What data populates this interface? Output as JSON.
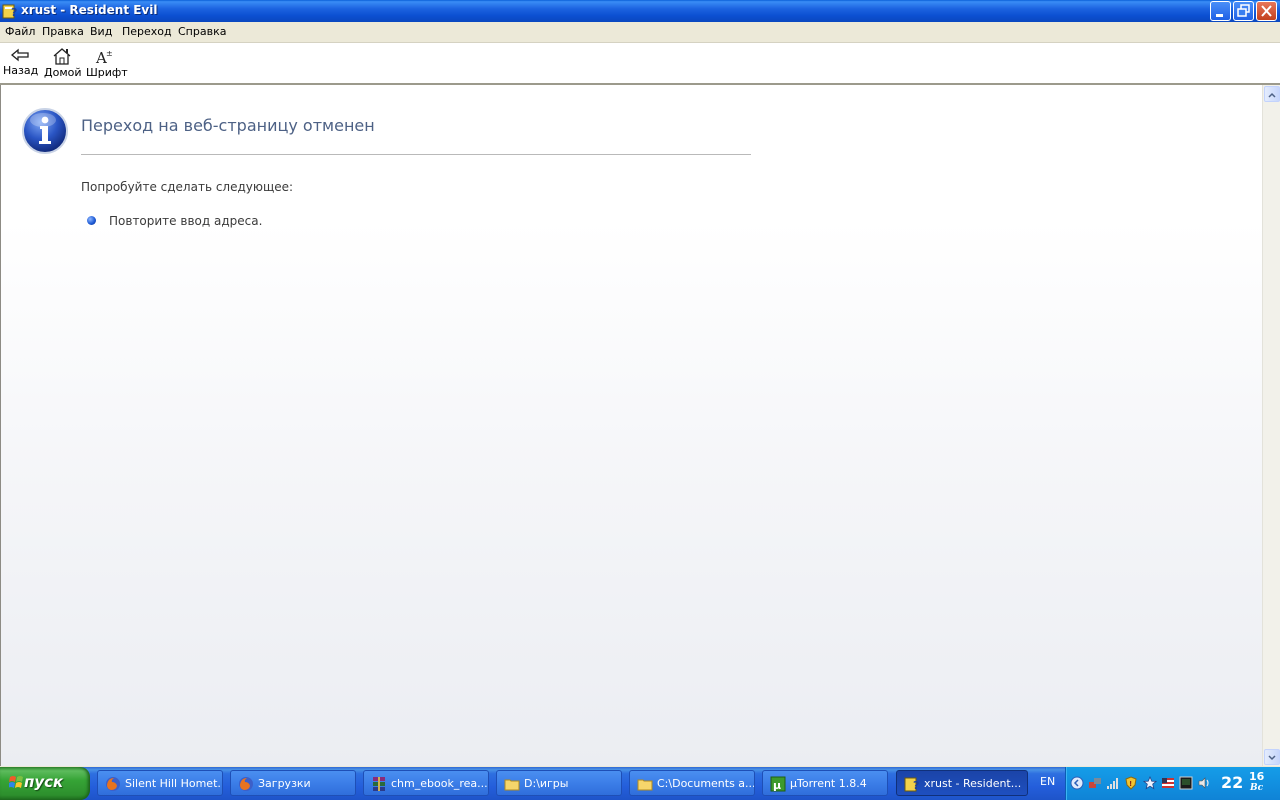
{
  "window": {
    "title": "xrust - Resident Evil"
  },
  "menu": {
    "items": [
      "Файл",
      "Правка",
      "Вид",
      "Переход",
      "Справка"
    ]
  },
  "toolbar": {
    "back": "Назад",
    "home": "Домой",
    "font": "Шрифт"
  },
  "page": {
    "heading": "Переход на веб-страницу отменен",
    "try_text": "Попробуйте сделать следующее:",
    "bullet": "Повторите ввод адреса."
  },
  "taskbar": {
    "start": "пуск",
    "tasks": [
      {
        "label": "Silent Hill Homet...",
        "icon": "firefox-icon"
      },
      {
        "label": "Загрузки",
        "icon": "firefox-icon"
      },
      {
        "label": "chm_ebook_rea...",
        "icon": "winrar-icon"
      },
      {
        "label": "D:\\игры",
        "icon": "folder-icon"
      },
      {
        "label": "C:\\Documents a...",
        "icon": "folder-icon"
      },
      {
        "label": "µTorrent 1.8.4",
        "icon": "utorrent-icon"
      },
      {
        "label": "xrust - Resident...",
        "icon": "chm-help-icon",
        "active": true
      }
    ],
    "language": "EN",
    "clock": {
      "hours": "22",
      "minutes": "16",
      "day": "Вс"
    }
  },
  "colors": {
    "titlebar": "#0c50d2",
    "heading": "#4d6185",
    "taskbar": "#245edb",
    "start": "#36a436",
    "tray": "#1290e0"
  }
}
